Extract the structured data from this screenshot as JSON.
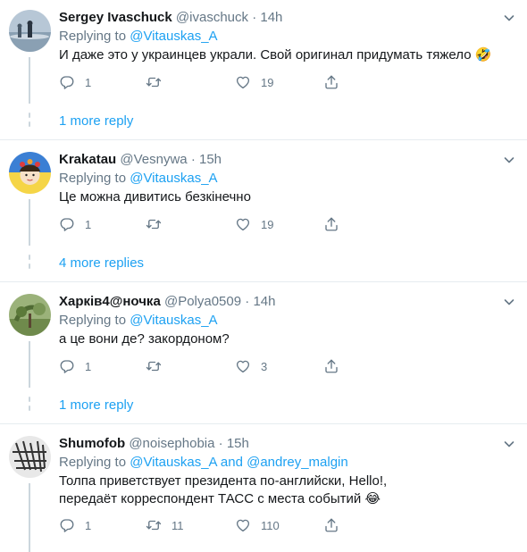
{
  "tweets": [
    {
      "name": "Sergey Ivaschuck",
      "handle": "@ivaschuck",
      "time": "14h",
      "replying_prefix": "Replying to",
      "mention1": "@Vitauskas_A",
      "mention_join": "",
      "mention2": "",
      "text": "И даже это у украинцев украли. Свой оригинал придумать тяжело 🤣",
      "reply_count": "1",
      "retweet_count": "",
      "like_count": "19",
      "more_label": "1 more reply"
    },
    {
      "name": "Krakatau",
      "handle": "@Vesnywa",
      "time": "15h",
      "replying_prefix": "Replying to",
      "mention1": "@Vitauskas_A",
      "mention_join": "",
      "mention2": "",
      "text": "Це можна дивитись безкінечно",
      "reply_count": "1",
      "retweet_count": "",
      "like_count": "19",
      "more_label": "4 more replies"
    },
    {
      "name": "Харків4@ночка",
      "handle": "@Polya0509",
      "time": "14h",
      "replying_prefix": "Replying to",
      "mention1": "@Vitauskas_A",
      "mention_join": "",
      "mention2": "",
      "text": "а це вони де? закордоном?",
      "reply_count": "1",
      "retweet_count": "",
      "like_count": "3",
      "more_label": "1 more reply"
    },
    {
      "name": "Shumofob",
      "handle": "@noisephobia",
      "time": "15h",
      "replying_prefix": "Replying to",
      "mention1": "@Vitauskas_A",
      "mention_join": "and",
      "mention2": "@andrey_malgin",
      "text": "Толпа приветствует президента по-английски, Hello!, передаёт корреспондент ТАСС с места событий 😂",
      "reply_count": "1",
      "retweet_count": "11",
      "like_count": "110",
      "more_label": ""
    }
  ],
  "separator": "·",
  "icons": {
    "reply": "reply-icon",
    "retweet": "retweet-icon",
    "like": "heart-icon",
    "share": "share-icon",
    "caret": "chevron-down-icon"
  },
  "colors": {
    "link": "#1da1f2",
    "muted": "#657786",
    "line": "#ccd6dd",
    "divider": "#e6ecf0"
  }
}
